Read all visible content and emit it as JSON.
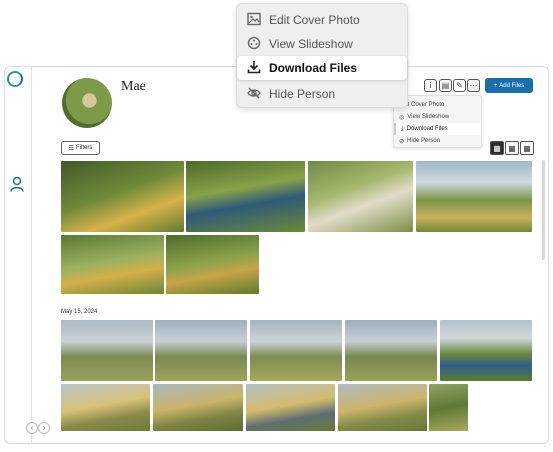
{
  "profile": {
    "name": "Mae"
  },
  "toolbar": {
    "add_files": "Add Files"
  },
  "context_menu": {
    "items": [
      {
        "label": "Edit Cover Photo",
        "icon": "image-icon"
      },
      {
        "label": "View Slideshow",
        "icon": "slideshow-icon"
      },
      {
        "label": "Download Files",
        "icon": "download-icon"
      },
      {
        "label": "Hide Person",
        "icon": "eye-off-icon"
      }
    ],
    "selected_index": 2
  },
  "filters": {
    "label": "Filters"
  },
  "view_modes": [
    "large-grid",
    "medium-grid",
    "small-grid"
  ],
  "section_date": "May 15, 2024",
  "colors": {
    "accent": "#1b6fa8",
    "brand_green": "#2e9e7a"
  }
}
